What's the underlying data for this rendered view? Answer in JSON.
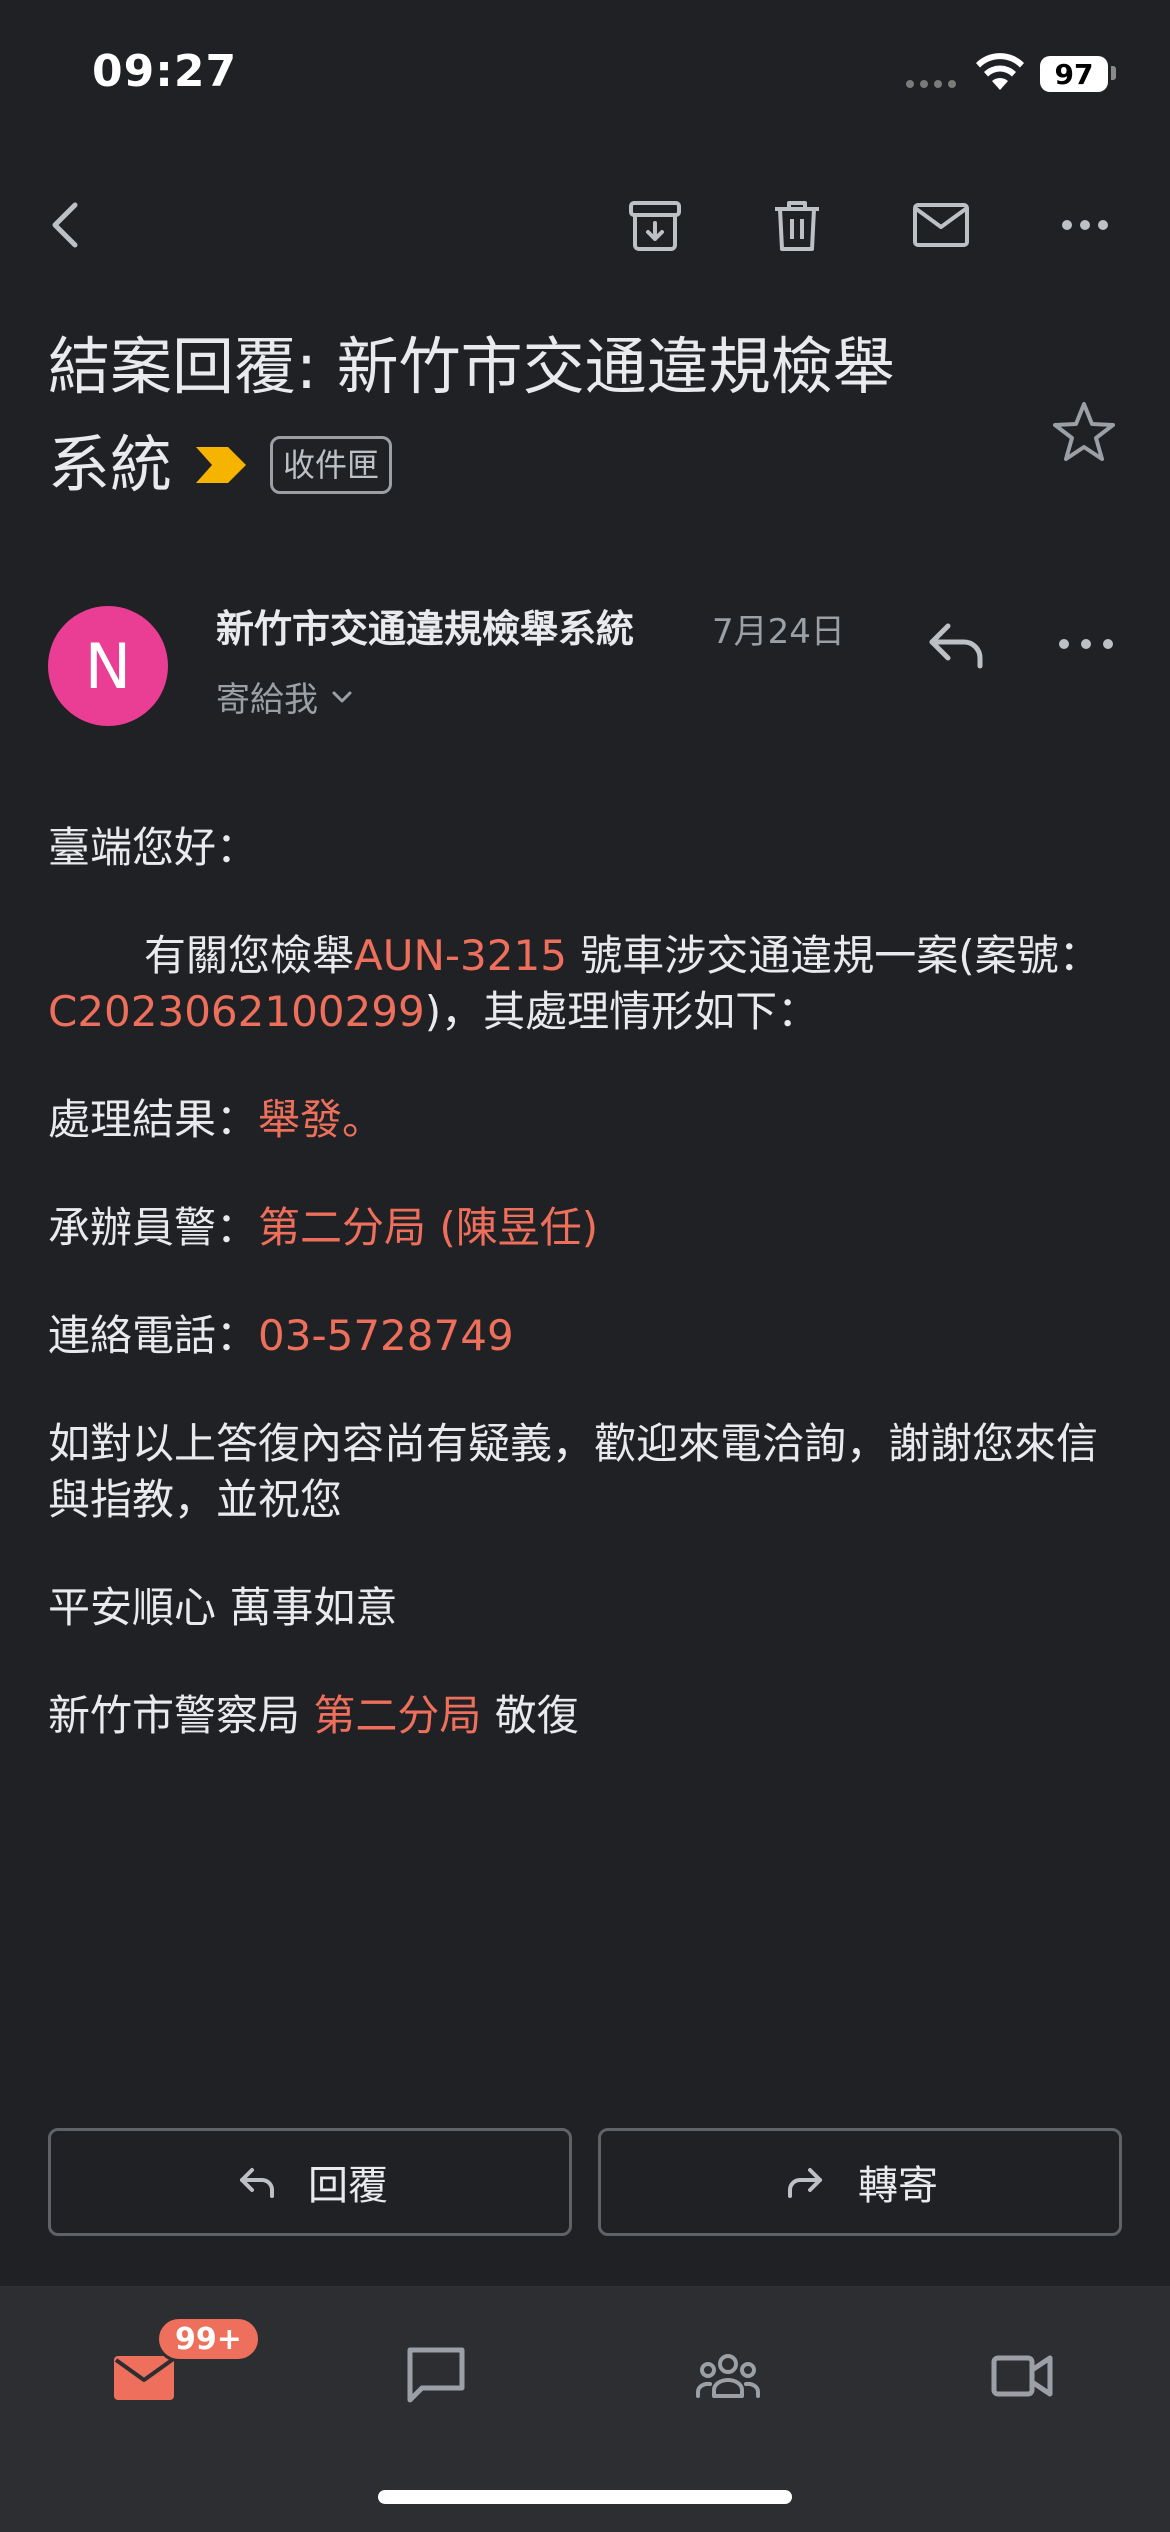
{
  "status_bar": {
    "time": "09:27",
    "battery": "97"
  },
  "email": {
    "subject": "結案回覆: 新竹市交通違規檢舉",
    "subject_cont": "系統",
    "label": "收件匣",
    "sender_initial": "N",
    "sender_name": "新竹市交通違規檢舉系統",
    "date": "7月24日",
    "recipient": "寄給我"
  },
  "body": {
    "greeting": "臺端您好：",
    "p1_a": "有關您檢舉",
    "p1_plate": "AUN-3215",
    "p1_b": " 號車涉交通違規一案(案號：",
    "p1_case": "C2023062100299",
    "p1_c": ")，其處理情形如下：",
    "result_label": "處理結果：",
    "result_value": "舉發。",
    "officer_label": "承辦員警：",
    "officer_value": "第二分局 (陳昱任)",
    "phone_label": "連絡電話：",
    "phone_value": "03-5728749",
    "p_inquiry": "如對以上答復內容尚有疑義，歡迎來電洽詢，謝謝您來信與指教，並祝您",
    "p_wish": "平安順心 萬事如意",
    "sign_a": "新竹市警察局 ",
    "sign_branch": "第二分局",
    "sign_b": " 敬復"
  },
  "actions": {
    "reply": "回覆",
    "forward": "轉寄"
  },
  "nav": {
    "mail_badge": "99+"
  },
  "colors": {
    "background": "#202124",
    "highlight": "#ee6f5b",
    "avatar": "#ea3d94",
    "importance": "#f6b400",
    "nav_bg": "#2d2e31"
  }
}
